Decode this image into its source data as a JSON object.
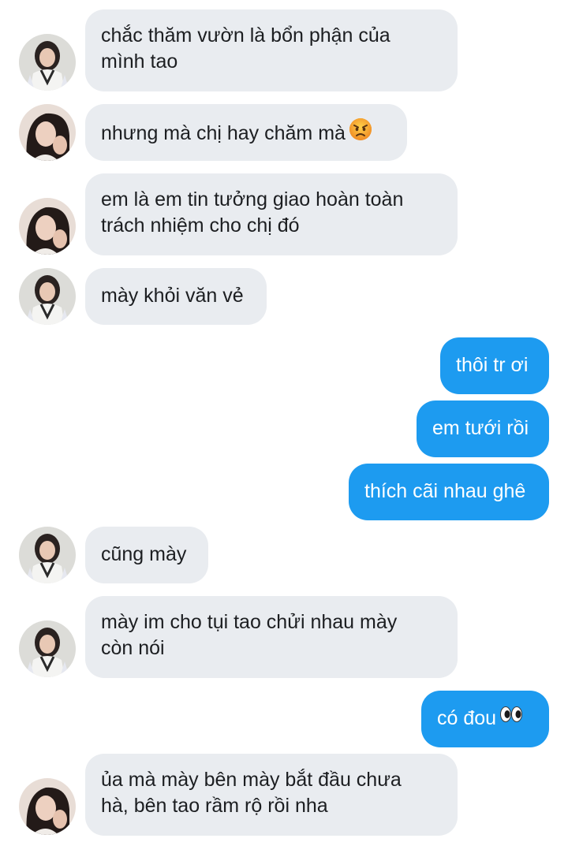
{
  "messages": [
    {
      "direction": "in",
      "avatar": "girl-white-vest",
      "text": "chắc thăm vườn là bổn phận của\nmình tao"
    },
    {
      "direction": "in",
      "avatar": "girl-selfie",
      "text": "nhưng mà chị hay chăm mà",
      "emoji": "angry-face-icon"
    },
    {
      "direction": "in",
      "avatar": "girl-selfie",
      "text": "em là em tin tưởng giao hoàn toàn\ntrách nhiệm cho chị đó"
    },
    {
      "direction": "in",
      "avatar": "girl-white-vest",
      "text": "mày khỏi văn vẻ"
    },
    {
      "direction": "out",
      "text": "thôi tr ơi"
    },
    {
      "direction": "out",
      "text": "em tưới rồi"
    },
    {
      "direction": "out",
      "text": "thích cãi nhau ghê"
    },
    {
      "direction": "in",
      "avatar": "girl-white-vest",
      "text": "cũng mày"
    },
    {
      "direction": "in",
      "avatar": "girl-white-vest",
      "text": "mày im cho tụi tao chửi nhau mày\ncòn nói"
    },
    {
      "direction": "out",
      "text": "có đou",
      "emoji": "eyes-icon"
    },
    {
      "direction": "in",
      "avatar": "girl-selfie",
      "text": "ủa mà mày bên mày bắt đầu chưa\nhà, bên tao rầm rộ rồi nha"
    }
  ],
  "colors": {
    "incoming_bubble": "#e9ecf0",
    "outgoing_bubble": "#1d9bf0",
    "incoming_text": "#1c1e21",
    "outgoing_text": "#ffffff"
  }
}
